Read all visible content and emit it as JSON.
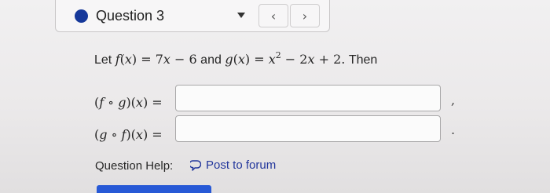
{
  "header": {
    "question_title": "Question 3",
    "prev_label": "‹",
    "next_label": "›",
    "status_dot_color": "#16389a",
    "caret_icon": "caret-down-icon",
    "prev_icon": "chevron-left-icon",
    "next_icon": "chevron-right-icon"
  },
  "statement": {
    "let": "Let",
    "f_name": "f",
    "f_arg": "x",
    "f_rhs_coef": "7",
    "f_rhs_var": "x",
    "f_rhs_rest": " − 6",
    "and": "and",
    "g_name": "g",
    "g_arg": "x",
    "g_rhs_var1": "x",
    "g_rhs_exp": "2",
    "g_rhs_mid": " − 2",
    "g_rhs_var2": "x",
    "g_rhs_rest": " + 2.",
    "then": "Then"
  },
  "answers": [
    {
      "left": "f",
      "op": " ∘ ",
      "right": "g",
      "arg": "x",
      "value": "",
      "trailing": ","
    },
    {
      "left": "g",
      "op": " ∘ ",
      "right": "f",
      "arg": "x",
      "value": "",
      "trailing": "."
    }
  ],
  "help": {
    "label": "Question Help:",
    "link_label": "Post to forum",
    "link_icon": "speech-bubble-icon",
    "link_color": "#23379c"
  },
  "bottom_button_color": "#2759d6"
}
